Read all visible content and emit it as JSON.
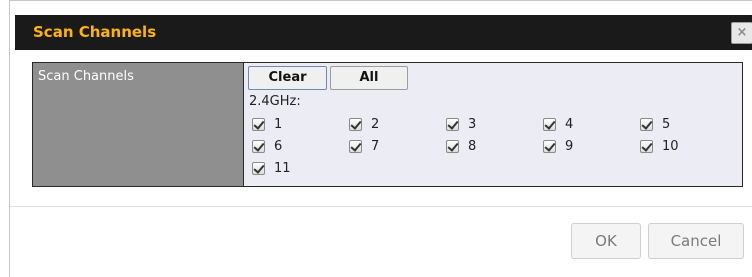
{
  "dialog": {
    "title": "Scan Channels",
    "close_label": "×"
  },
  "form": {
    "row_label": "Scan Channels",
    "clear_label": "Clear",
    "all_label": "All",
    "band_label": "2.4GHz:",
    "channels": [
      {
        "label": "1",
        "checked": true
      },
      {
        "label": "2",
        "checked": true
      },
      {
        "label": "3",
        "checked": true
      },
      {
        "label": "4",
        "checked": true
      },
      {
        "label": "5",
        "checked": true
      },
      {
        "label": "6",
        "checked": true
      },
      {
        "label": "7",
        "checked": true
      },
      {
        "label": "8",
        "checked": true
      },
      {
        "label": "9",
        "checked": true
      },
      {
        "label": "10",
        "checked": true
      },
      {
        "label": "11",
        "checked": true
      }
    ]
  },
  "footer": {
    "ok_label": "OK",
    "cancel_label": "Cancel"
  },
  "colors": {
    "title_bar": "#1a1a1a",
    "title_text": "#ffb400",
    "label_cell": "#8f8f8f",
    "value_cell": "#ececf4"
  },
  "icons": {
    "close": "close-icon",
    "checkbox": "checkbox-checked-icon"
  }
}
